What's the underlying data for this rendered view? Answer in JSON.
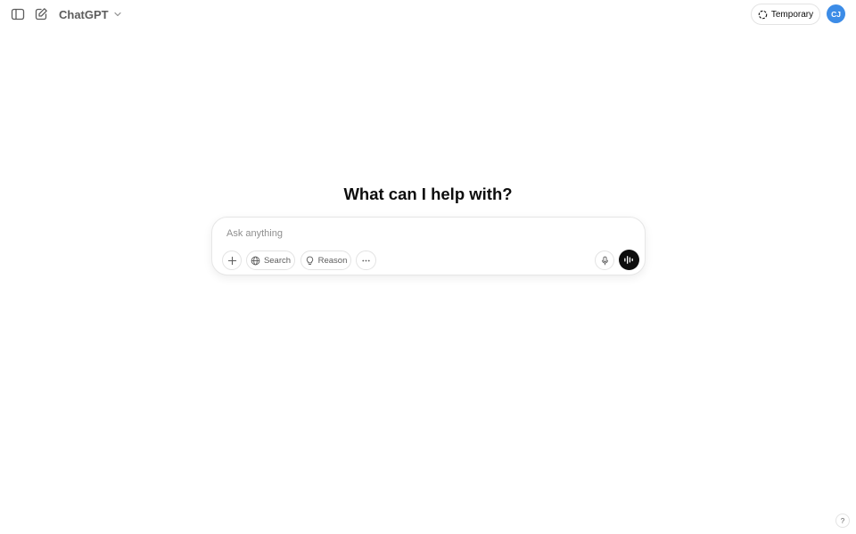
{
  "header": {
    "model_name": "ChatGPT",
    "temporary_label": "Temporary",
    "avatar_initials": "CJ",
    "icons": {
      "sidebar": "sidebar-toggle-icon",
      "new_chat": "edit-icon",
      "model_menu": "chevron-down-icon",
      "temporary": "dashed-circle-icon"
    }
  },
  "main": {
    "heading": "What can I help with?"
  },
  "composer": {
    "placeholder": "Ask anything",
    "value": "",
    "tools": {
      "search_label": "Search",
      "reason_label": "Reason"
    },
    "icons": {
      "attach": "plus-icon",
      "search": "globe-icon",
      "reason": "lightbulb-icon",
      "more": "ellipsis-icon",
      "dictate": "microphone-icon",
      "voice": "voice-wave-icon"
    }
  },
  "footer": {
    "help_label": "?"
  },
  "colors": {
    "text": "#0d0d0d",
    "muted": "#5d5d5d",
    "placeholder": "#8f8f8f",
    "border": "#e3e3e3",
    "avatar_bg": "#3c8ce7",
    "voice_button_bg": "#0d0d0d"
  }
}
